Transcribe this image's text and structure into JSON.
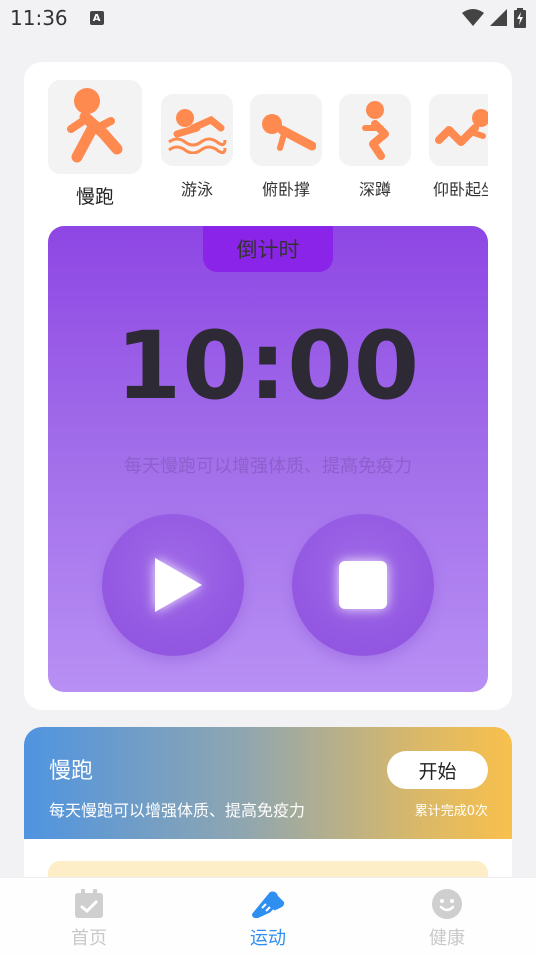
{
  "status_bar": {
    "time": "11:36",
    "notification_icon": "A"
  },
  "exercise_tabs": [
    {
      "label": "慢跑",
      "icon": "jogging-icon",
      "active": true
    },
    {
      "label": "游泳",
      "icon": "swimming-icon",
      "active": false
    },
    {
      "label": "俯卧撑",
      "icon": "pushup-icon",
      "active": false
    },
    {
      "label": "深蹲",
      "icon": "squat-icon",
      "active": false
    },
    {
      "label": "仰卧起坐",
      "icon": "situp-icon",
      "active": false
    }
  ],
  "timer": {
    "mode_label": "倒计时",
    "time": "10:00",
    "motto": "每天慢跑可以增强体质、提高免疫力"
  },
  "info_card": {
    "title": "慢跑",
    "description": "每天慢跑可以增强体质、提高免疫力",
    "start_label": "开始",
    "completed_count": "累计完成0次"
  },
  "bottom_nav": [
    {
      "label": "首页",
      "icon": "calendar-check-icon",
      "active": false
    },
    {
      "label": "运动",
      "icon": "sneaker-icon",
      "active": true
    },
    {
      "label": "健康",
      "icon": "smiley-icon",
      "active": false
    }
  ],
  "colors": {
    "accent_orange": "#ff8a50",
    "timer_gradient_top": "#8e46e4",
    "timer_gradient_bottom": "#b890f4",
    "nav_active": "#2f8ff0",
    "nav_inactive": "#c9c9c9"
  }
}
